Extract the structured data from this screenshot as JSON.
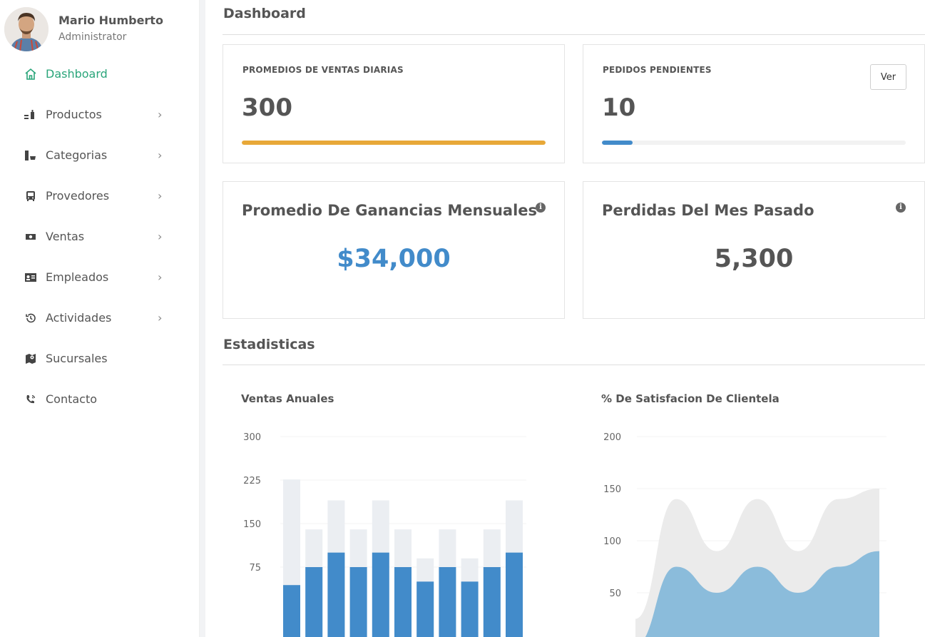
{
  "profile": {
    "name": "Mario Humberto",
    "role": "Administrator"
  },
  "sidebar": {
    "items": [
      {
        "label": "Dashboard",
        "icon": "home-icon",
        "active": true,
        "has_submenu": false
      },
      {
        "label": "Productos",
        "icon": "products-icon",
        "active": false,
        "has_submenu": true
      },
      {
        "label": "Categorias",
        "icon": "categories-icon",
        "active": false,
        "has_submenu": true
      },
      {
        "label": "Provedores",
        "icon": "bus-icon",
        "active": false,
        "has_submenu": true
      },
      {
        "label": "Ventas",
        "icon": "money-icon",
        "active": false,
        "has_submenu": true
      },
      {
        "label": "Empleados",
        "icon": "id-card-icon",
        "active": false,
        "has_submenu": true
      },
      {
        "label": "Actividades",
        "icon": "history-icon",
        "active": false,
        "has_submenu": true
      },
      {
        "label": "Sucursales",
        "icon": "map-marker-icon",
        "active": false,
        "has_submenu": false
      },
      {
        "label": "Contacto",
        "icon": "phone-icon",
        "active": false,
        "has_submenu": false
      }
    ],
    "chevron": "›"
  },
  "dashboard": {
    "title": "Dashboard",
    "daily_sales": {
      "label": "PROMEDIOS DE VENTAS DIARIAS",
      "value": "300",
      "progress": 1.0,
      "color": "#e8a838"
    },
    "pending_orders": {
      "label": "PEDIDOS PENDIENTES",
      "value": "10",
      "progress": 0.1,
      "color": "#428bca",
      "button": "Ver"
    },
    "monthly_profit": {
      "label": "Promedio De Ganancias Mensuales",
      "value": "$34,000",
      "color": "#428bca"
    },
    "last_month_losses": {
      "label": "Perdidas Del Mes Pasado",
      "value": "5,300",
      "color": "#555555"
    }
  },
  "stats": {
    "title": "Estadisticas"
  },
  "chart_data": [
    {
      "type": "bar",
      "title": "Ventas Anuales",
      "ylim": [
        0,
        300
      ],
      "yticks": [
        75,
        150,
        225,
        300
      ],
      "series": [
        {
          "values": [
            44,
            75,
            100,
            75,
            100,
            75,
            50,
            75,
            50,
            75,
            100
          ],
          "color": "#428bca"
        },
        {
          "values": [
            226,
            140,
            190,
            140,
            190,
            140,
            90,
            140,
            90,
            140,
            190
          ],
          "color": "#ebeef2"
        }
      ]
    },
    {
      "type": "area",
      "title": "% De Satisfacion De Clientela",
      "ylim": [
        0,
        200
      ],
      "yticks": [
        50,
        100,
        150,
        200
      ],
      "series": [
        {
          "values": [
            25,
            140,
            90,
            140,
            90,
            140,
            150
          ],
          "color": "#ebebeb"
        },
        {
          "values": [
            0,
            75,
            50,
            75,
            50,
            75,
            90
          ],
          "color": "#8bbcdb"
        }
      ]
    }
  ]
}
